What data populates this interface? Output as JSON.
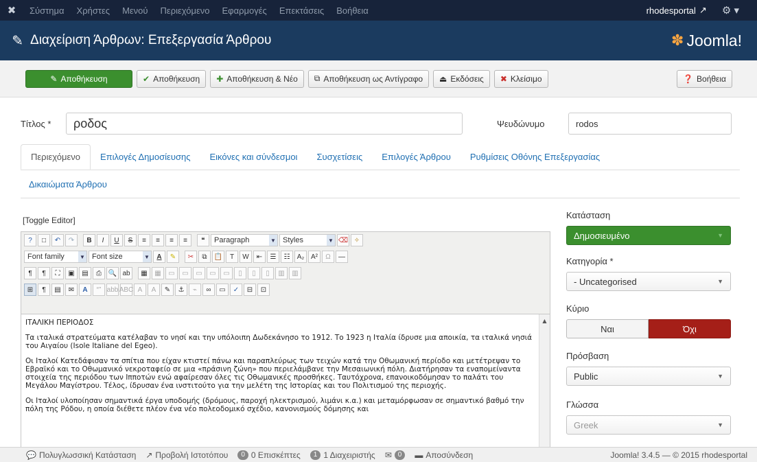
{
  "topnav": {
    "menu": [
      "Σύστημα",
      "Χρήστες",
      "Μενού",
      "Περιεχόμενο",
      "Εφαρμογές",
      "Επεκτάσεις",
      "Βοήθεια"
    ],
    "site": "rhodesportal"
  },
  "header": {
    "title": "Διαχείριση Άρθρων: Επεξεργασία Άρθρου",
    "brand": "Joomla!"
  },
  "toolbar": {
    "save": "Αποθήκευση",
    "save_close": "Αποθήκευση",
    "save_new": "Αποθήκευση & Νέο",
    "save_copy": "Αποθήκευση ως Αντίγραφο",
    "versions": "Εκδόσεις",
    "close": "Κλείσιμο",
    "help": "Βοήθεια"
  },
  "form": {
    "title_label": "Τίτλος *",
    "title_value": "ροδος",
    "alias_label": "Ψευδώνυμο",
    "alias_value": "rodos"
  },
  "tabs": [
    "Περιεχόμενο",
    "Επιλογές Δημοσίευσης",
    "Εικόνες και σύνδεσμοι",
    "Συσχετίσεις",
    "Επιλογές Άρθρου",
    "Ρυθμίσεις Οθόνης Επεξεργασίας",
    "Δικαιώματα Άρθρου"
  ],
  "editor": {
    "toggle": "[Toggle Editor]",
    "format": "Paragraph",
    "styles": "Styles",
    "font_family": "Font family",
    "font_size": "Font size",
    "content": [
      "ΙΤΑΛΙΚΗ ΠΕΡΙΟΔΟΣ",
      "Τα ιταλικά στρατεύματα κατέλαβαν το νησί και την υπόλοιπη Δωδεκάνησο το 1912. Το 1923 η Ιταλία ίδρυσε μια αποικία, τα ιταλικά νησιά του Αιγαίου (Isole Italiane del Egeo).",
      "Οι Ιταλοί Κατεδάφισαν τα σπίτια που είχαν κτιστεί πάνω και παραπλεύρως των τειχών κατά την Οθωμανική περίοδο και μετέτρεψαν το Εβραϊκό και το Οθωμανικό νεκροταφείο σε μια «πράσινη ζώνη» που περιελάμβανε την Μεσαιωνική πόλη. Διατήρησαν τα εναπομείναντα στοιχεία της περιόδου των Ιπποτών ενώ αφαίρεσαν όλες τις Οθωμανικές προσθήκες. Ταυτόχρονα, επανοικοδόμησαν το παλάτι του Μεγάλου Μαγίστρου. Τέλος, ίδρυσαν ένα ινστιτούτο για την μελέτη της Ιστορίας και του Πολιτισμού της περιοχής.",
      "Οι Ιταλοί υλοποίησαν σημαντικά έργα υποδομής (δρόμους, παροχή ηλεκτρισμού, λιμάνι κ.α.) και μεταμόρφωσαν σε σημαντικό βαθμό την πόλη της Ρόδου, η οποία διέθετε πλέον ένα νέο πολεοδομικό σχέδιο, κανονισμούς δόμησης και"
    ]
  },
  "sidebar": {
    "status_label": "Κατάσταση",
    "status_value": "Δημοσιευμένο",
    "category_label": "Κατηγορία *",
    "category_value": "- Uncategorised",
    "featured_label": "Κύριο",
    "yes": "Ναι",
    "no": "Όχι",
    "access_label": "Πρόσβαση",
    "access_value": "Public",
    "language_label": "Γλώσσα",
    "language_value": "Greek"
  },
  "footer": {
    "multilingual": "Πολυγλωσσική Κατάσταση",
    "view_site": "Προβολή Ιστοτόπου",
    "visitors_count": "0",
    "visitors": "0 Επισκέπτες",
    "admins_count": "1",
    "admins": "1 Διαχειριστής",
    "messages_count": "0",
    "logout": "Αποσύνδεση",
    "version": "Joomla! 3.4.5 — © 2015 rhodesportal"
  },
  "colors": {
    "nav": "#17233a",
    "header": "#1b3b5f",
    "green": "#3b8f2e",
    "red": "#a51f18",
    "link": "#1f6fb2"
  }
}
